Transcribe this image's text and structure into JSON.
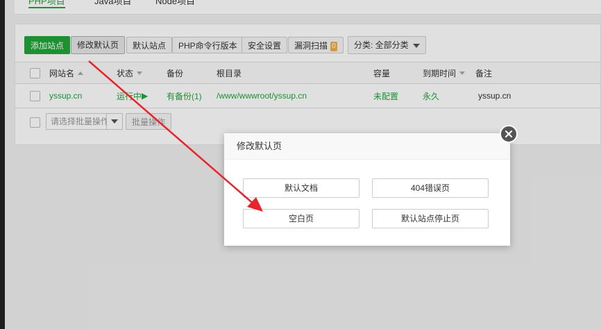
{
  "tabs": [
    {
      "label": "PHP项目",
      "active": true
    },
    {
      "label": "Java项目",
      "active": false
    },
    {
      "label": "Node项目",
      "active": false
    }
  ],
  "toolbar": {
    "add_site": "添加站点",
    "edit_default_page": "修改默认页",
    "default_site": "默认站点",
    "php_cli_version": "PHP命令行版本",
    "security_settings": "安全设置",
    "vuln_scan": "漏洞扫描",
    "vuln_count": "0",
    "category": "分类: 全部分类"
  },
  "table": {
    "headers": {
      "name": "网站名",
      "status": "状态",
      "backup": "备份",
      "root": "根目录",
      "capacity": "容量",
      "expire": "到期时间",
      "remark": "备注"
    },
    "rows": [
      {
        "name": "yssup.cn",
        "status": "运行中",
        "status_icon": "▶",
        "backup": "有备份(1)",
        "root": "/www/wwwroot/yssup.cn",
        "capacity": "未配置",
        "expire": "永久",
        "remark": "yssup.cn"
      }
    ]
  },
  "batch": {
    "placeholder": "请选择批量操作",
    "button": "批量操作"
  },
  "modal": {
    "title": "修改默认页",
    "buttons": [
      "默认文档",
      "404错误页",
      "空白页",
      "默认站点停止页"
    ]
  },
  "colors": {
    "accent": "#20a53a",
    "arrow": "#e8242a",
    "badge": "#f0ad4e"
  }
}
